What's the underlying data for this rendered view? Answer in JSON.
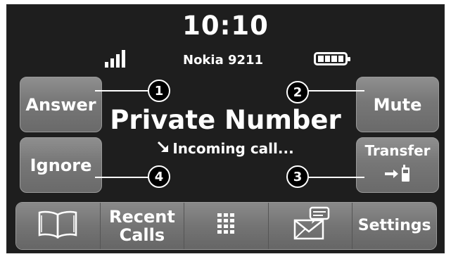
{
  "status": {
    "time": "10:10",
    "device": "Nokia 9211"
  },
  "call": {
    "title": "Private Number",
    "status": "Incoming call..."
  },
  "buttons": {
    "answer": "Answer",
    "mute": "Mute",
    "ignore": "Ignore",
    "transfer": "Transfer"
  },
  "callouts": [
    "1",
    "2",
    "3",
    "4"
  ],
  "toolbar": {
    "items": [
      {
        "icon": "phonebook-icon"
      },
      {
        "line1": "Recent",
        "line2": "Calls"
      },
      {
        "icon": "keypad-icon"
      },
      {
        "icon": "messages-icon"
      },
      {
        "label": "Settings"
      }
    ]
  }
}
